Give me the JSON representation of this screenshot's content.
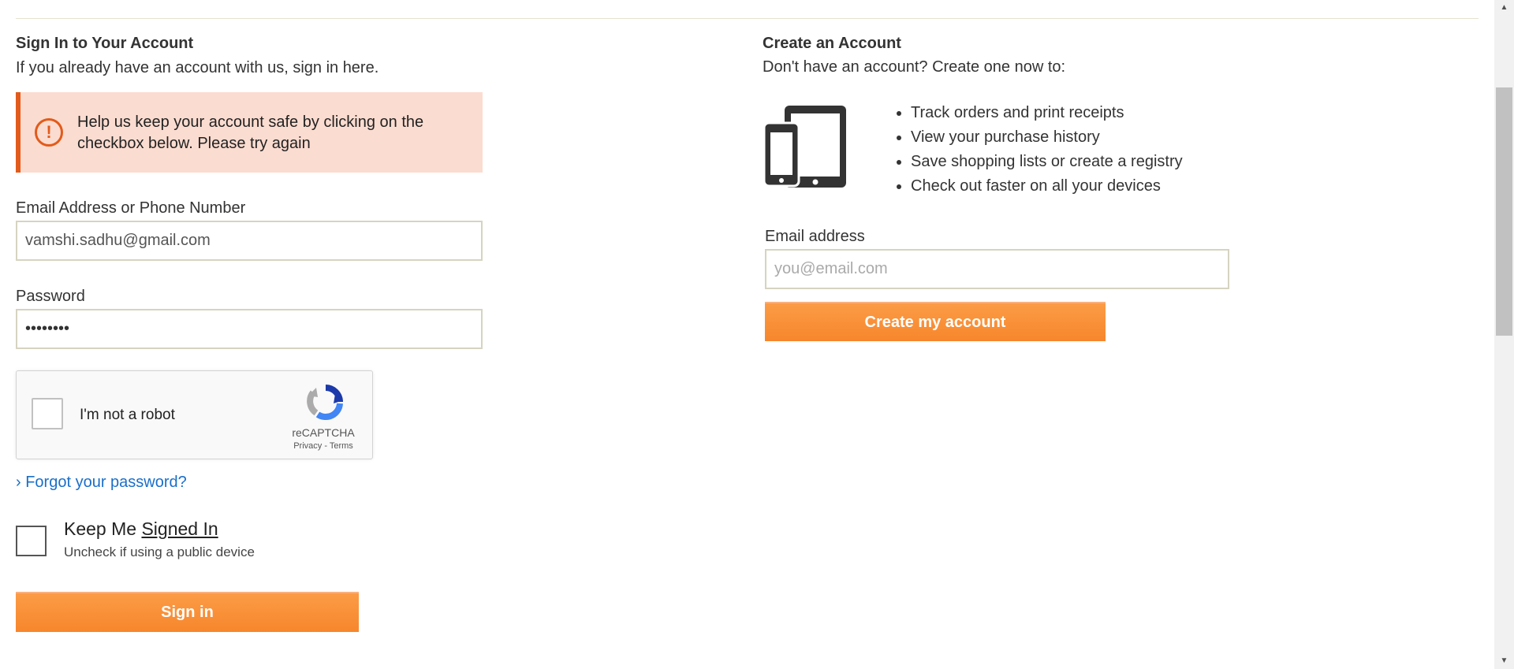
{
  "signin": {
    "title": "Sign In to Your Account",
    "subtitle": "If you already have an account with us, sign in here.",
    "alert_icon": "exclamation-circle-icon",
    "alert_text": "Help us keep your account safe by clicking on the checkbox below. Please try again",
    "email_label": "Email Address or Phone Number",
    "email_value": "vamshi.sadhu@gmail.com",
    "password_label": "Password",
    "password_value": "••••••••",
    "captcha_label": "I'm not a robot",
    "captcha_brand": "reCAPTCHA",
    "captcha_links": "Privacy - Terms",
    "forgot_link": "› Forgot your password?",
    "keep_title_prefix": "Keep Me ",
    "keep_title_underlined": "Signed In",
    "keep_sub": "Uncheck if using a public device",
    "signin_button": "Sign in"
  },
  "create": {
    "title": "Create an Account",
    "subtitle": "Don't have an account? Create one now to:",
    "devices_icon": "devices-icon",
    "benefits": [
      "Track orders and print receipts",
      "View your purchase history",
      "Save shopping lists or create a registry",
      "Check out faster on all your devices"
    ],
    "email_label": "Email address",
    "email_placeholder": "you@email.com",
    "create_button": "Create my account"
  },
  "colors": {
    "accent": "#f7862c",
    "alert_bg": "#fbdcd0",
    "alert_border": "#e25b1a",
    "link": "#1a6fc9"
  }
}
